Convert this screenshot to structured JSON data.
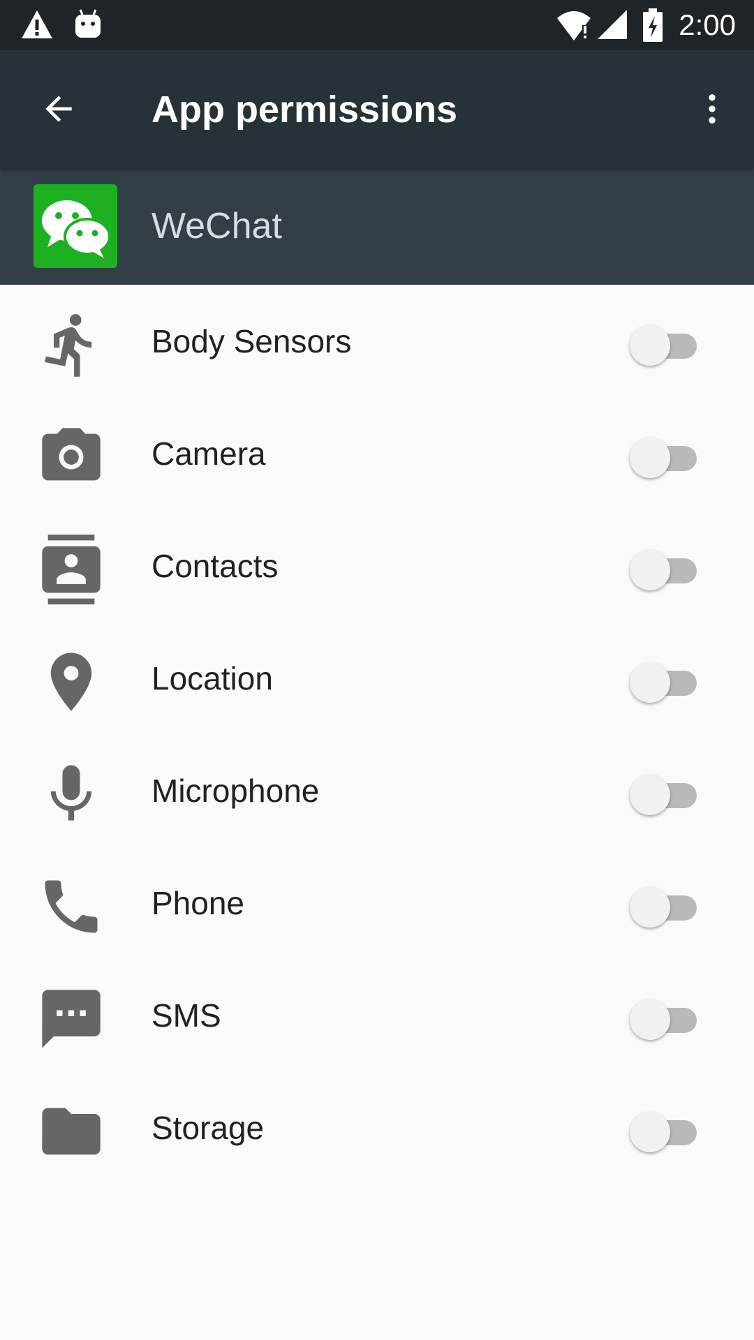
{
  "status_bar": {
    "time": "2:00",
    "icons": [
      "warning-icon",
      "android-icon",
      "wifi-alert-icon",
      "signal-icon",
      "battery-charging-icon"
    ]
  },
  "toolbar": {
    "title": "App permissions",
    "back_icon": "arrow-back-icon",
    "menu_icon": "more-vert-icon"
  },
  "app": {
    "name": "WeChat",
    "icon": "wechat-logo-icon",
    "icon_color": "#1db121"
  },
  "permissions": [
    {
      "label": "Body Sensors",
      "icon": "run-icon",
      "enabled": false
    },
    {
      "label": "Camera",
      "icon": "camera-icon",
      "enabled": false
    },
    {
      "label": "Contacts",
      "icon": "contacts-icon",
      "enabled": false
    },
    {
      "label": "Location",
      "icon": "location-pin-icon",
      "enabled": false
    },
    {
      "label": "Microphone",
      "icon": "microphone-icon",
      "enabled": false
    },
    {
      "label": "Phone",
      "icon": "phone-icon",
      "enabled": false
    },
    {
      "label": "SMS",
      "icon": "sms-icon",
      "enabled": false
    },
    {
      "label": "Storage",
      "icon": "folder-icon",
      "enabled": false
    }
  ],
  "colors": {
    "toolbar": "#263238",
    "app_header": "#323f48",
    "status_bar": "#1e2428",
    "icon_gray": "#666666",
    "switch_off_track": "#b9b9b9"
  }
}
